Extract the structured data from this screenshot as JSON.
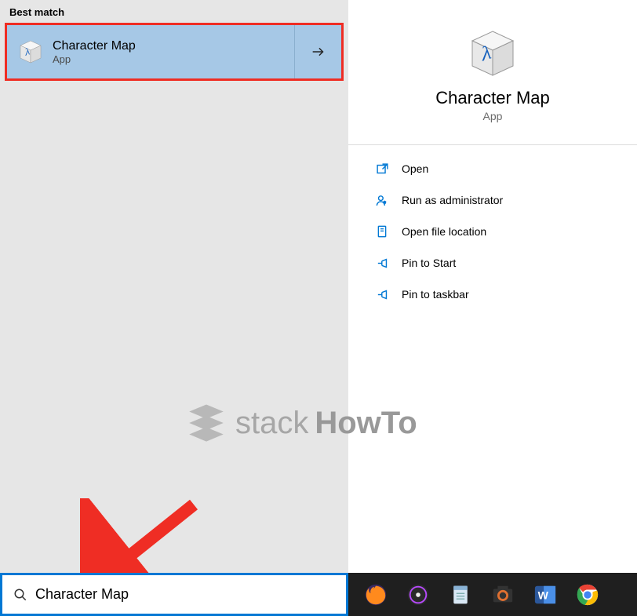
{
  "left": {
    "section_label": "Best match",
    "result": {
      "title": "Character Map",
      "subtitle": "App"
    }
  },
  "detail": {
    "title": "Character Map",
    "subtitle": "App",
    "actions": [
      {
        "icon": "open-icon",
        "label": "Open"
      },
      {
        "icon": "admin-icon",
        "label": "Run as administrator"
      },
      {
        "icon": "folder-icon",
        "label": "Open file location"
      },
      {
        "icon": "pin-icon",
        "label": "Pin to Start"
      },
      {
        "icon": "pin-icon",
        "label": "Pin to taskbar"
      }
    ]
  },
  "watermark": {
    "word1": "stack",
    "word2": "HowTo"
  },
  "search": {
    "value": "Character Map"
  },
  "taskbar_icons": [
    "firefox-icon",
    "media-icon",
    "notepad-icon",
    "camera-icon",
    "word-icon",
    "chrome-icon"
  ]
}
